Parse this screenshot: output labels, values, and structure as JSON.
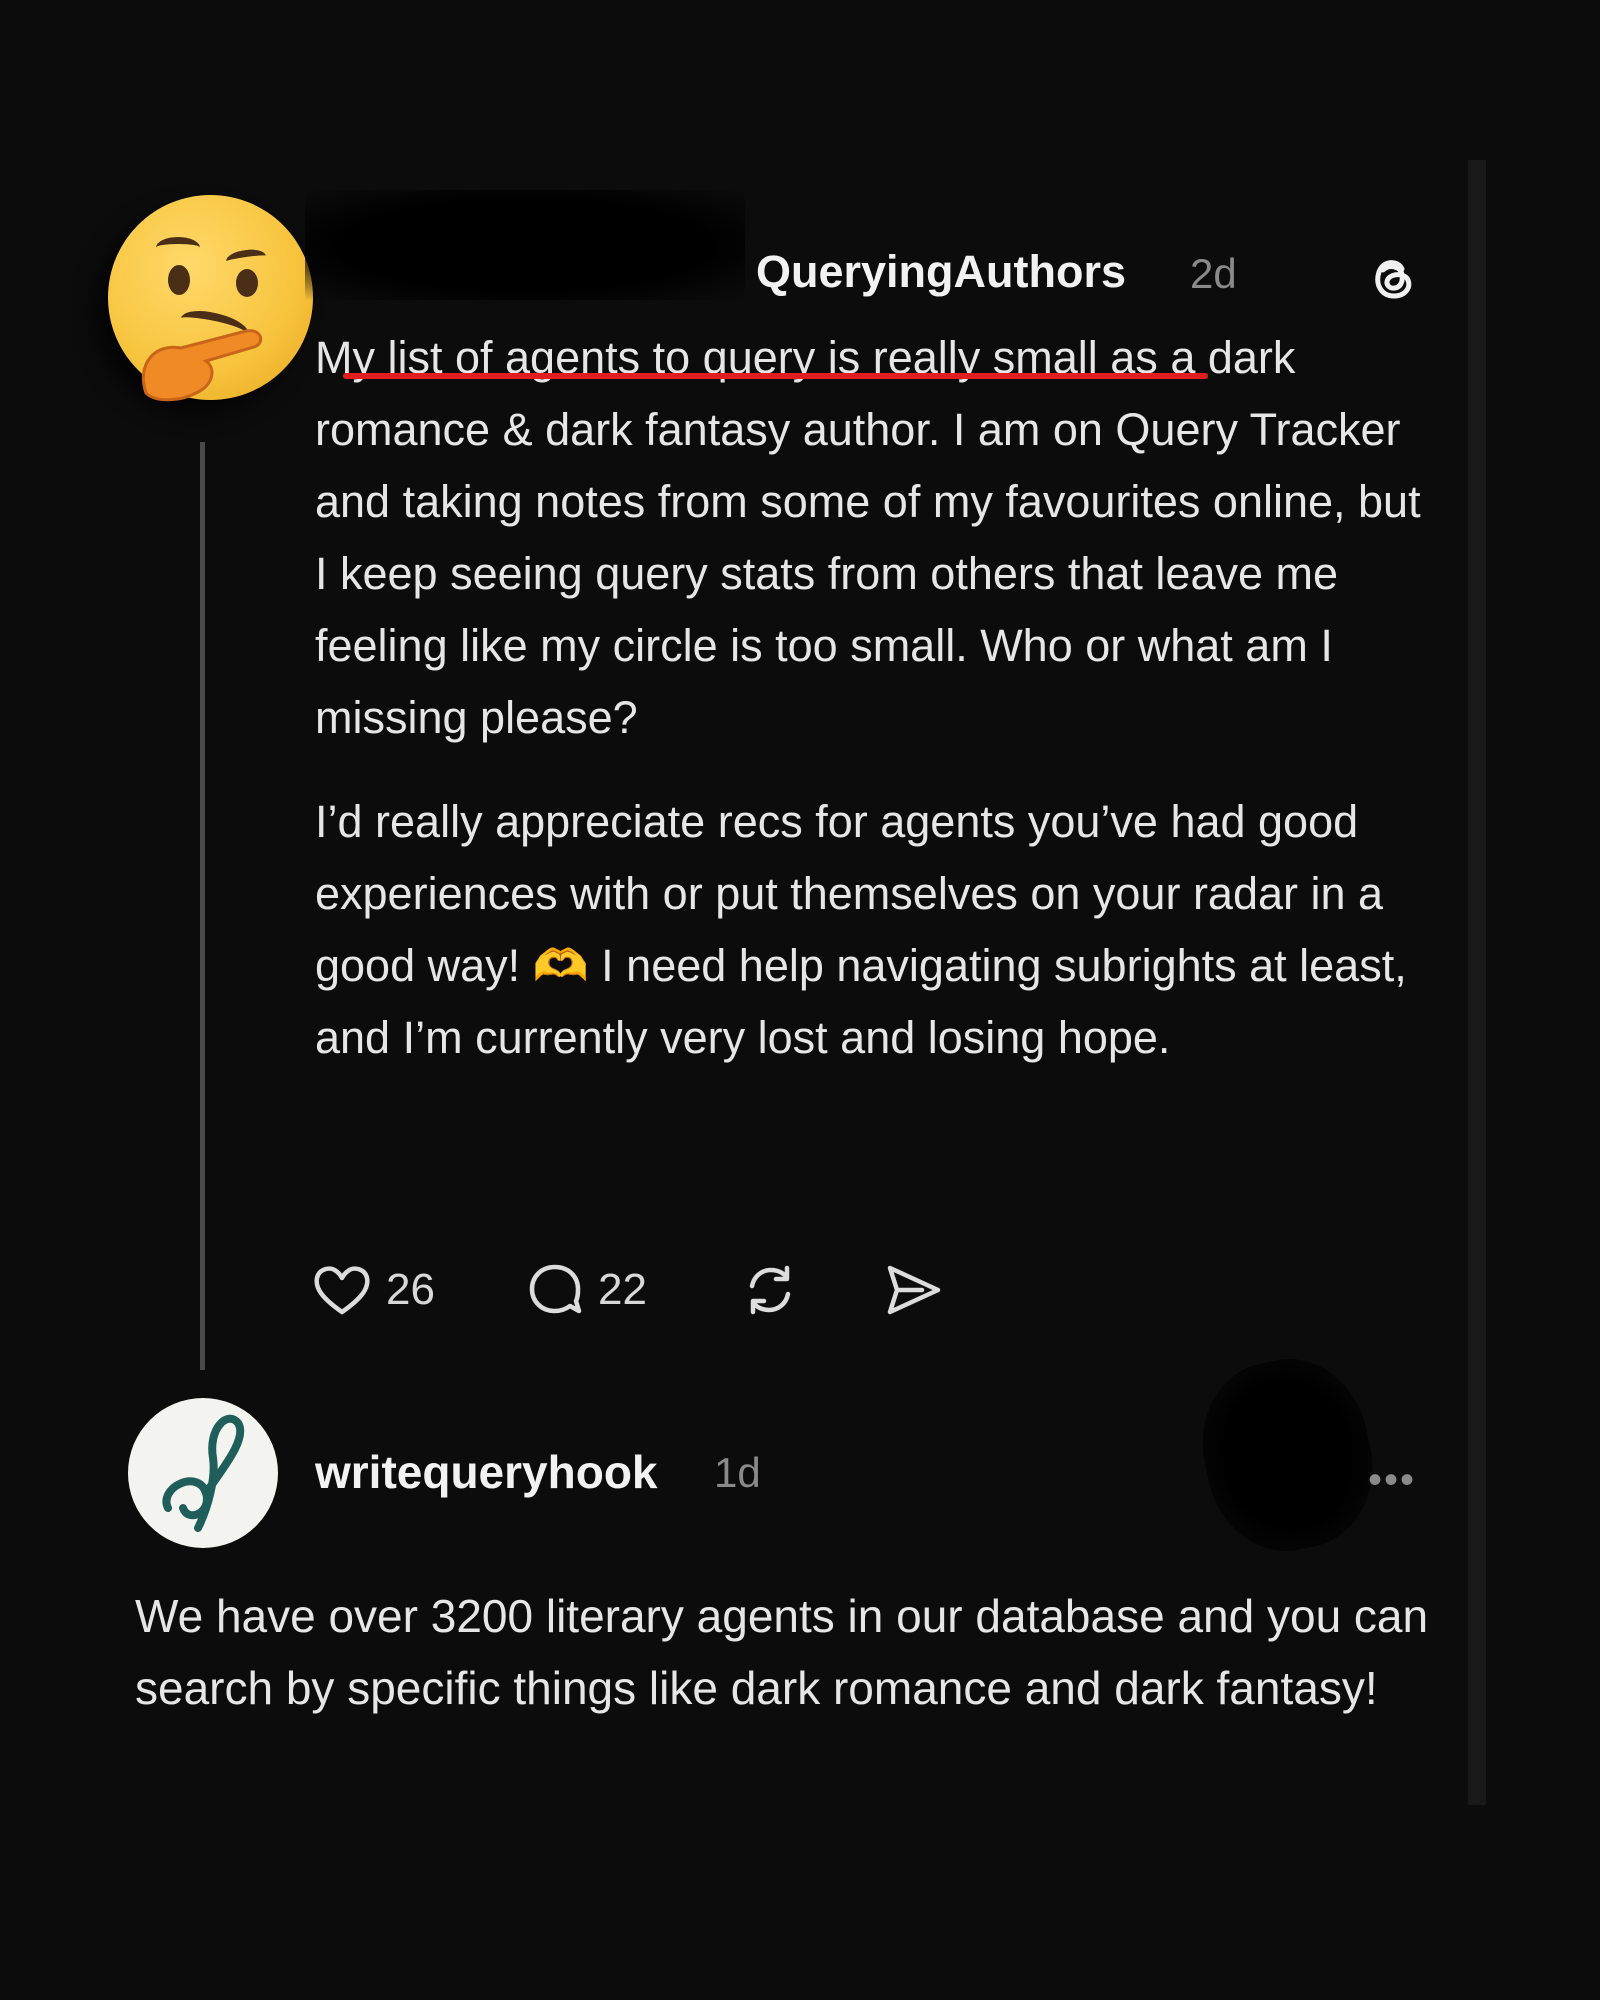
{
  "post": {
    "username": "QueryingAuthors",
    "time": "2d",
    "text_highlight": "My list of agents to query is really small",
    "text_rest": " as a dark romance & dark fantasy author. I am on Query Tracker and taking notes from some of my favourites online, but I keep seeing query stats from others that leave me feeling like my circle is too small. Who or what am I missing please?",
    "text_second_a": "I’d really appreciate recs for agents you’ve had good experiences with or put themselves on your radar in a good way! ",
    "heart_hands": "🫶",
    "text_second_b": " I need help navigating subrights at least, and I’m currently very lost and losing hope.",
    "likes": "26",
    "comments": "22"
  },
  "reply": {
    "username": "writequeryhook",
    "time": "1d",
    "more": "•••",
    "text": "We have over 3200 literary agents in our database and you can search by specific things like dark romance and dark fantasy!"
  },
  "icons": [
    "thinking-face-emoji",
    "threads-logo-icon",
    "heart-icon",
    "comment-icon",
    "repost-icon",
    "share-icon",
    "more-icon"
  ],
  "colors": {
    "background": "#0c0c0c",
    "highlight_underline": "#e11d1d",
    "muted": "#8a8a8a",
    "avatar_script": "#1f5e5a"
  }
}
